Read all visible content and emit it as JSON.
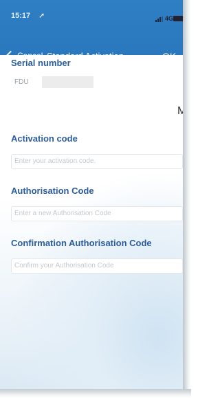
{
  "status_bar": {
    "time": "15:17",
    "network": "4G"
  },
  "nav_bar": {
    "cancel_label": "Cancel",
    "title": "Standard Activation",
    "ok_label": "OK"
  },
  "form": {
    "serial": {
      "label": "Serial number",
      "value": "FDU"
    },
    "activation_code": {
      "label": "Activation code",
      "placeholder": "Enter your activation code."
    },
    "authorisation_code": {
      "label": "Authorisation Code",
      "placeholder": "Enter a new Authorisation Code"
    },
    "confirmation_code": {
      "label": "Confirmation Authorisation Code",
      "placeholder": "Confirm your Authorisation Code"
    }
  },
  "side_text": "M",
  "colors": {
    "header_blue": "#2f7fc4",
    "label_blue": "#2b5d9e"
  }
}
